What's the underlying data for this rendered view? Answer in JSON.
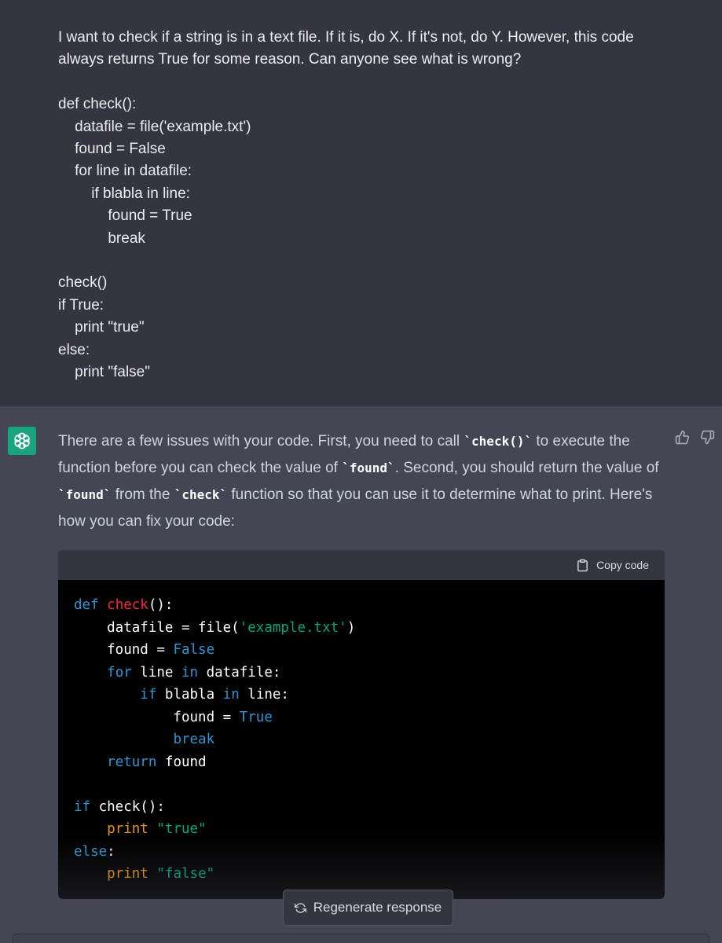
{
  "user_message": {
    "text": "I want to check if a string is in a text file. If it is, do X. If it's not, do Y. However, this code always returns True for some reason. Can anyone see what is wrong?\n\ndef check():\n    datafile = file('example.txt')\n    found = False\n    for line in datafile:\n        if blabla in line:\n            found = True\n            break\n\ncheck()\nif True:\n    print \"true\"\nelse:\n    print \"false\""
  },
  "assistant": {
    "avatar_icon": "openai-logo-icon",
    "avatar_color": "#19a37f",
    "paragraph": {
      "t1": "There are a few issues with your code. First, you need to call ",
      "c1": "`check()`",
      "t2": " to execute the function before you can check the value of ",
      "c2": "`found`",
      "t3": ". Second, you should return the value of ",
      "c3": "`found`",
      "t4": " from the ",
      "c4": "`check`",
      "t5": " function so that you can use it to determine what to print. Here's how you can fix your code:"
    },
    "feedback": {
      "like_icon": "thumbs-up-icon",
      "dislike_icon": "thumbs-down-icon"
    },
    "code_block": {
      "copy_label": "Copy code",
      "copy_icon": "clipboard-icon",
      "lines": [
        [
          {
            "t": "def",
            "c": "kw"
          },
          {
            "t": " "
          },
          {
            "t": "check",
            "c": "fn"
          },
          {
            "t": "():"
          }
        ],
        [
          {
            "t": "    datafile = file("
          },
          {
            "t": "'example.txt'",
            "c": "st"
          },
          {
            "t": ")"
          }
        ],
        [
          {
            "t": "    found = "
          },
          {
            "t": "False",
            "c": "kw"
          }
        ],
        [
          {
            "t": "    "
          },
          {
            "t": "for",
            "c": "kw"
          },
          {
            "t": " line "
          },
          {
            "t": "in",
            "c": "kw"
          },
          {
            "t": " datafile:"
          }
        ],
        [
          {
            "t": "        "
          },
          {
            "t": "if",
            "c": "kw"
          },
          {
            "t": " blabla "
          },
          {
            "t": "in",
            "c": "kw"
          },
          {
            "t": " line:"
          }
        ],
        [
          {
            "t": "            found = "
          },
          {
            "t": "True",
            "c": "kw"
          }
        ],
        [
          {
            "t": "            "
          },
          {
            "t": "break",
            "c": "kw"
          }
        ],
        [
          {
            "t": "    "
          },
          {
            "t": "return",
            "c": "kw"
          },
          {
            "t": " found"
          }
        ],
        [
          {
            "t": ""
          }
        ],
        [
          {
            "t": "if",
            "c": "kw"
          },
          {
            "t": " check():"
          }
        ],
        [
          {
            "t": "    "
          },
          {
            "t": "print",
            "c": "pr"
          },
          {
            "t": " "
          },
          {
            "t": "\"true\"",
            "c": "st"
          }
        ],
        [
          {
            "t": "else",
            "c": "kw"
          },
          {
            "t": ":"
          }
        ],
        [
          {
            "t": "    "
          },
          {
            "t": "print",
            "c": "pr"
          },
          {
            "t": " "
          },
          {
            "t": "\"false\"",
            "c": "st"
          }
        ]
      ]
    }
  },
  "regenerate": {
    "label": "Regenerate response",
    "icon": "refresh-icon"
  },
  "colors": {
    "user_bg": "#343541",
    "assistant_bg": "#444654",
    "keyword": "#2e95d3",
    "function": "#f22c3d",
    "string": "#00a67d",
    "print": "#e9950c"
  }
}
